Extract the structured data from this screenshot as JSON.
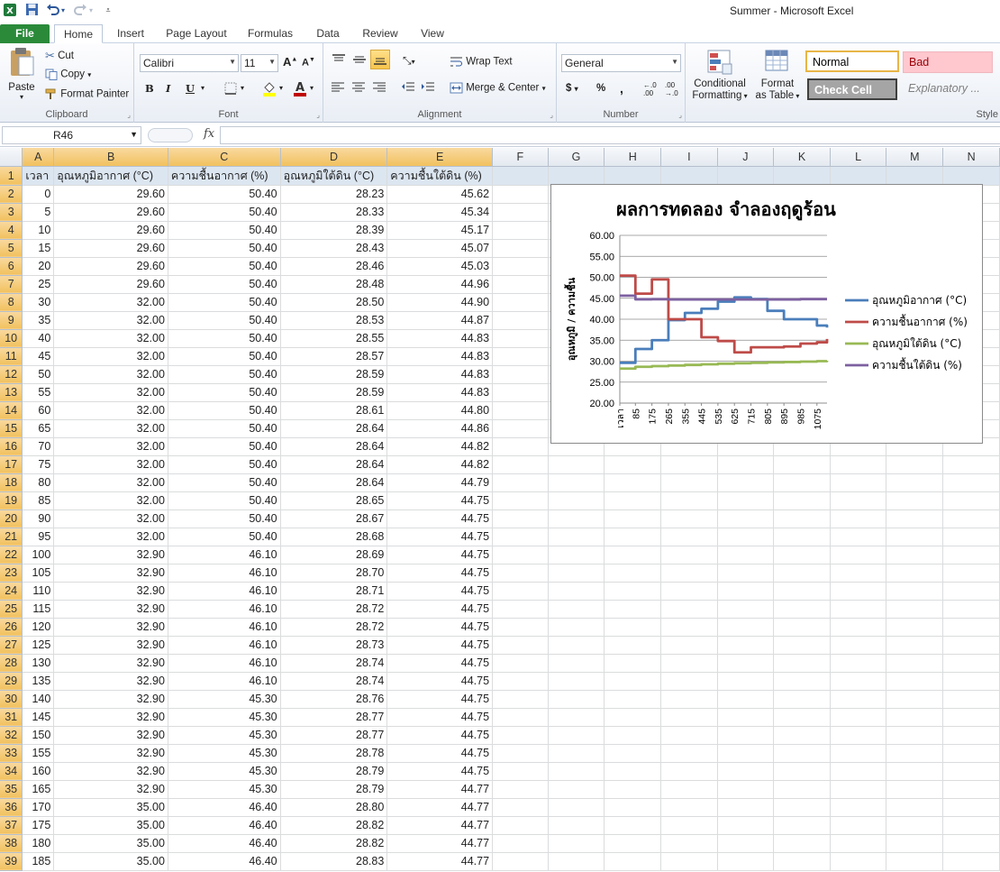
{
  "window": {
    "title": "Summer  -  Microsoft Excel"
  },
  "quick_access": {
    "icons": [
      "excel-logo-icon",
      "save-icon",
      "undo-icon",
      "redo-icon",
      "customize-icon"
    ]
  },
  "tabs": [
    "File",
    "Home",
    "Insert",
    "Page Layout",
    "Formulas",
    "Data",
    "Review",
    "View"
  ],
  "ribbon": {
    "clipboard": {
      "label": "Clipboard",
      "paste": "Paste",
      "cut": "Cut",
      "copy": "Copy",
      "format_painter": "Format Painter"
    },
    "font": {
      "label": "Font",
      "font_name": "Calibri",
      "font_size": "11",
      "font_color": "#c00000",
      "fill_color": "#ffff00"
    },
    "alignment": {
      "label": "Alignment",
      "wrap_text": "Wrap Text",
      "merge_center": "Merge & Center"
    },
    "number": {
      "label": "Number",
      "format": "General"
    },
    "styles": {
      "label": "Style",
      "conditional_formatting": [
        "Conditional",
        "Formatting"
      ],
      "format_as_table": [
        "Format",
        "as Table"
      ],
      "normal": "Normal",
      "bad": "Bad",
      "check_cell": "Check Cell",
      "explanatory": "Explanatory ..."
    }
  },
  "formula_bar": {
    "name_box": "R46",
    "fx": "fx",
    "formula": ""
  },
  "grid": {
    "columns": [
      "A",
      "B",
      "C",
      "D",
      "E",
      "F",
      "G",
      "H",
      "I",
      "J",
      "K",
      "L",
      "M",
      "N"
    ],
    "header_row": [
      "เวลา",
      "อุณหภูมิอากาศ (°C)",
      "ความชื้นอากาศ (%)",
      "อุณหภูมิใต้ดิน (°C)",
      "ความชื้นใต้ดิน (%)"
    ],
    "rows": [
      [
        "0",
        "29.60",
        "50.40",
        "28.23",
        "45.62"
      ],
      [
        "5",
        "29.60",
        "50.40",
        "28.33",
        "45.34"
      ],
      [
        "10",
        "29.60",
        "50.40",
        "28.39",
        "45.17"
      ],
      [
        "15",
        "29.60",
        "50.40",
        "28.43",
        "45.07"
      ],
      [
        "20",
        "29.60",
        "50.40",
        "28.46",
        "45.03"
      ],
      [
        "25",
        "29.60",
        "50.40",
        "28.48",
        "44.96"
      ],
      [
        "30",
        "32.00",
        "50.40",
        "28.50",
        "44.90"
      ],
      [
        "35",
        "32.00",
        "50.40",
        "28.53",
        "44.87"
      ],
      [
        "40",
        "32.00",
        "50.40",
        "28.55",
        "44.83"
      ],
      [
        "45",
        "32.00",
        "50.40",
        "28.57",
        "44.83"
      ],
      [
        "50",
        "32.00",
        "50.40",
        "28.59",
        "44.83"
      ],
      [
        "55",
        "32.00",
        "50.40",
        "28.59",
        "44.83"
      ],
      [
        "60",
        "32.00",
        "50.40",
        "28.61",
        "44.80"
      ],
      [
        "65",
        "32.00",
        "50.40",
        "28.64",
        "44.86"
      ],
      [
        "70",
        "32.00",
        "50.40",
        "28.64",
        "44.82"
      ],
      [
        "75",
        "32.00",
        "50.40",
        "28.64",
        "44.82"
      ],
      [
        "80",
        "32.00",
        "50.40",
        "28.64",
        "44.79"
      ],
      [
        "85",
        "32.00",
        "50.40",
        "28.65",
        "44.75"
      ],
      [
        "90",
        "32.00",
        "50.40",
        "28.67",
        "44.75"
      ],
      [
        "95",
        "32.00",
        "50.40",
        "28.68",
        "44.75"
      ],
      [
        "100",
        "32.90",
        "46.10",
        "28.69",
        "44.75"
      ],
      [
        "105",
        "32.90",
        "46.10",
        "28.70",
        "44.75"
      ],
      [
        "110",
        "32.90",
        "46.10",
        "28.71",
        "44.75"
      ],
      [
        "115",
        "32.90",
        "46.10",
        "28.72",
        "44.75"
      ],
      [
        "120",
        "32.90",
        "46.10",
        "28.72",
        "44.75"
      ],
      [
        "125",
        "32.90",
        "46.10",
        "28.73",
        "44.75"
      ],
      [
        "130",
        "32.90",
        "46.10",
        "28.74",
        "44.75"
      ],
      [
        "135",
        "32.90",
        "46.10",
        "28.74",
        "44.75"
      ],
      [
        "140",
        "32.90",
        "45.30",
        "28.76",
        "44.75"
      ],
      [
        "145",
        "32.90",
        "45.30",
        "28.77",
        "44.75"
      ],
      [
        "150",
        "32.90",
        "45.30",
        "28.77",
        "44.75"
      ],
      [
        "155",
        "32.90",
        "45.30",
        "28.78",
        "44.75"
      ],
      [
        "160",
        "32.90",
        "45.30",
        "28.79",
        "44.75"
      ],
      [
        "165",
        "32.90",
        "45.30",
        "28.79",
        "44.77"
      ],
      [
        "170",
        "35.00",
        "46.40",
        "28.80",
        "44.77"
      ],
      [
        "175",
        "35.00",
        "46.40",
        "28.82",
        "44.77"
      ],
      [
        "180",
        "35.00",
        "46.40",
        "28.82",
        "44.77"
      ],
      [
        "185",
        "35.00",
        "46.40",
        "28.83",
        "44.77"
      ]
    ]
  },
  "chart_data": {
    "type": "line",
    "title": "ผลการทดลอง จำลองฤดูร้อน",
    "ylabel": "อุณหภูมิ / ความชื้น",
    "xlabel": "",
    "ylim": [
      20,
      60
    ],
    "ytick_labels": [
      "60.00",
      "55.00",
      "50.00",
      "45.00",
      "40.00",
      "35.00",
      "30.00",
      "25.00",
      "20.00"
    ],
    "xtick_labels": [
      "เวลา",
      "85",
      "175",
      "265",
      "355",
      "445",
      "535",
      "625",
      "715",
      "805",
      "895",
      "985",
      "1075"
    ],
    "x": [
      0,
      85,
      175,
      265,
      355,
      445,
      535,
      625,
      715,
      805,
      895,
      985,
      1075,
      1130
    ],
    "grid": true,
    "legend_position": "right",
    "series": [
      {
        "name": "อุณหภูมิอากาศ (°C)",
        "color": "#4a7ebb",
        "values": [
          29.6,
          32.9,
          35.0,
          39.8,
          41.5,
          42.5,
          44.2,
          45.2,
          44.8,
          42.0,
          40.0,
          40.0,
          38.5,
          38.0
        ]
      },
      {
        "name": "ความชื้นอากาศ (%)",
        "color": "#be4b48",
        "values": [
          50.4,
          46.1,
          49.5,
          40.0,
          40.0,
          35.7,
          34.8,
          32.1,
          33.3,
          33.3,
          33.5,
          34.2,
          34.5,
          35.3
        ]
      },
      {
        "name": "อุณหภูมิใต้ดิน (°C)",
        "color": "#98b954",
        "values": [
          28.23,
          28.65,
          28.82,
          28.95,
          29.1,
          29.25,
          29.4,
          29.5,
          29.6,
          29.7,
          29.8,
          29.9,
          30.0,
          30.1
        ]
      },
      {
        "name": "ความชื้นใต้ดิน (%)",
        "color": "#7d60a0",
        "values": [
          45.62,
          44.75,
          44.77,
          44.7,
          44.7,
          44.7,
          44.7,
          44.7,
          44.7,
          44.7,
          44.7,
          44.8,
          44.8,
          44.8
        ]
      }
    ]
  }
}
